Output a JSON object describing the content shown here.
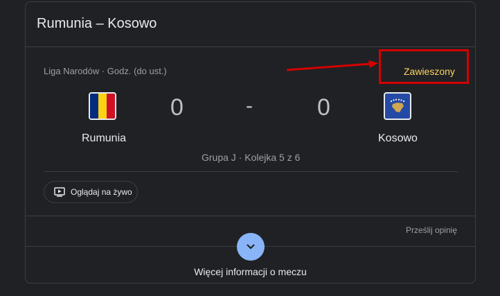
{
  "match": {
    "title": "Rumunia – Kosowo",
    "league": "Liga Narodów · Godz. (do ust.)",
    "status": "Zawieszony",
    "home_team": "Rumunia",
    "away_team": "Kosowo",
    "home_score": "0",
    "away_score": "0",
    "separator": "-",
    "group_info": "Grupa J · Kolejka 5 z 6"
  },
  "actions": {
    "watch_live": "Oglądaj na żywo",
    "feedback": "Prześlij opinię",
    "more_info": "Więcej informacji o meczu"
  },
  "colors": {
    "status": "#fdd663",
    "annotation": "#d50000",
    "accent": "#8ab4f8"
  },
  "icons": {
    "watch": "tv-play-icon",
    "expand": "chevron-down-icon",
    "annotation": "red-arrow-icon"
  }
}
